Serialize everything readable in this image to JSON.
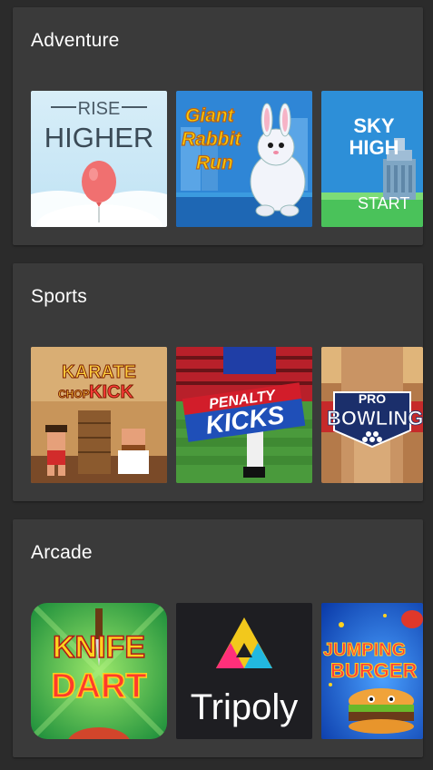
{
  "sections": [
    {
      "title": "Adventure",
      "games": [
        {
          "title_lines": [
            "RISE",
            "HIGHER"
          ]
        },
        {
          "title_lines": [
            "Giant",
            "Rabbit",
            "Run"
          ]
        },
        {
          "title_lines": [
            "SKY",
            "HIGH"
          ],
          "button": "START"
        }
      ]
    },
    {
      "title": "Sports",
      "games": [
        {
          "title_lines": [
            "KARATE",
            "CHOP",
            "KICK"
          ]
        },
        {
          "title_lines": [
            "PENALTY",
            "KICKS"
          ]
        },
        {
          "title_lines": [
            "PRO",
            "BOWLING"
          ]
        }
      ]
    },
    {
      "title": "Arcade",
      "games": [
        {
          "title_lines": [
            "KNIFE",
            "DART"
          ]
        },
        {
          "title_lines": [
            "Tripoly"
          ]
        },
        {
          "title_lines": [
            "JUMPING",
            "BURGER"
          ]
        }
      ]
    }
  ],
  "colors": {
    "background": "#2b2b2b",
    "card": "#3a3a3a",
    "title_text": "#ffffff"
  }
}
